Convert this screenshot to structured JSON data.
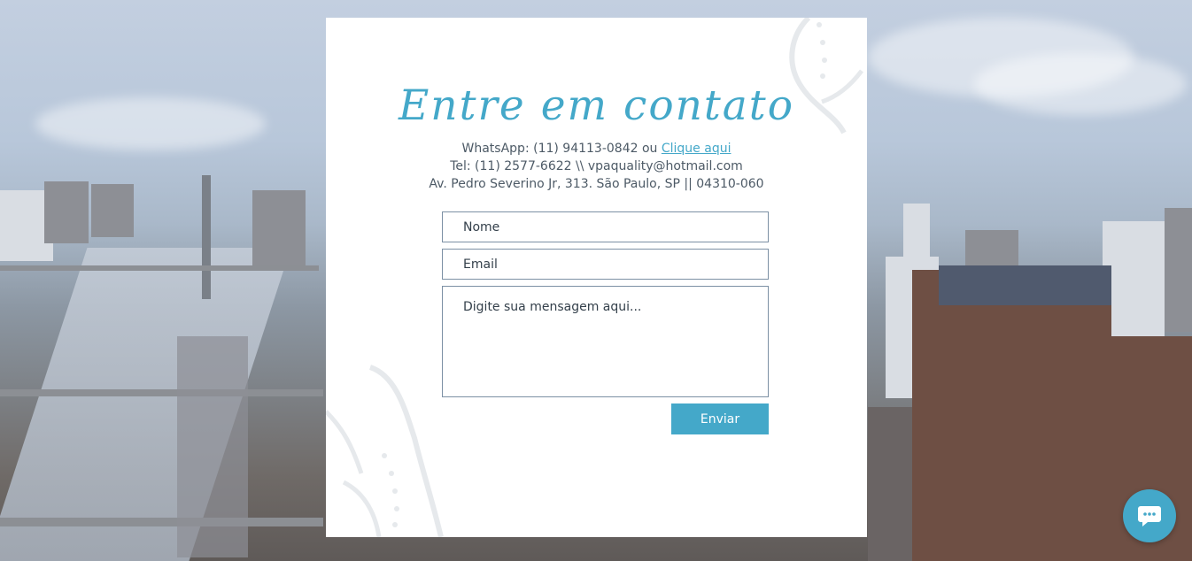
{
  "contact": {
    "title": "Entre em contato",
    "whatsapp_prefix": "WhatsApp: (11) 94113-0842 ou ",
    "whatsapp_link": "Clique aqui",
    "tel_line": "Tel: (11) 2577-6622 \\\\ vpaquality@hotmail.com",
    "address_line": "Av. Pedro Severino Jr, 313. São Paulo, SP || 04310-060"
  },
  "form": {
    "name_placeholder": "Nome",
    "email_placeholder": "Email",
    "message_placeholder": "Digite sua mensagem aqui...",
    "submit_label": "Enviar"
  },
  "chat": {
    "icon": "chat-bubble-icon"
  },
  "colors": {
    "accent": "#44a8c9",
    "text": "#4d5a66",
    "field_border": "#7c90a4"
  }
}
